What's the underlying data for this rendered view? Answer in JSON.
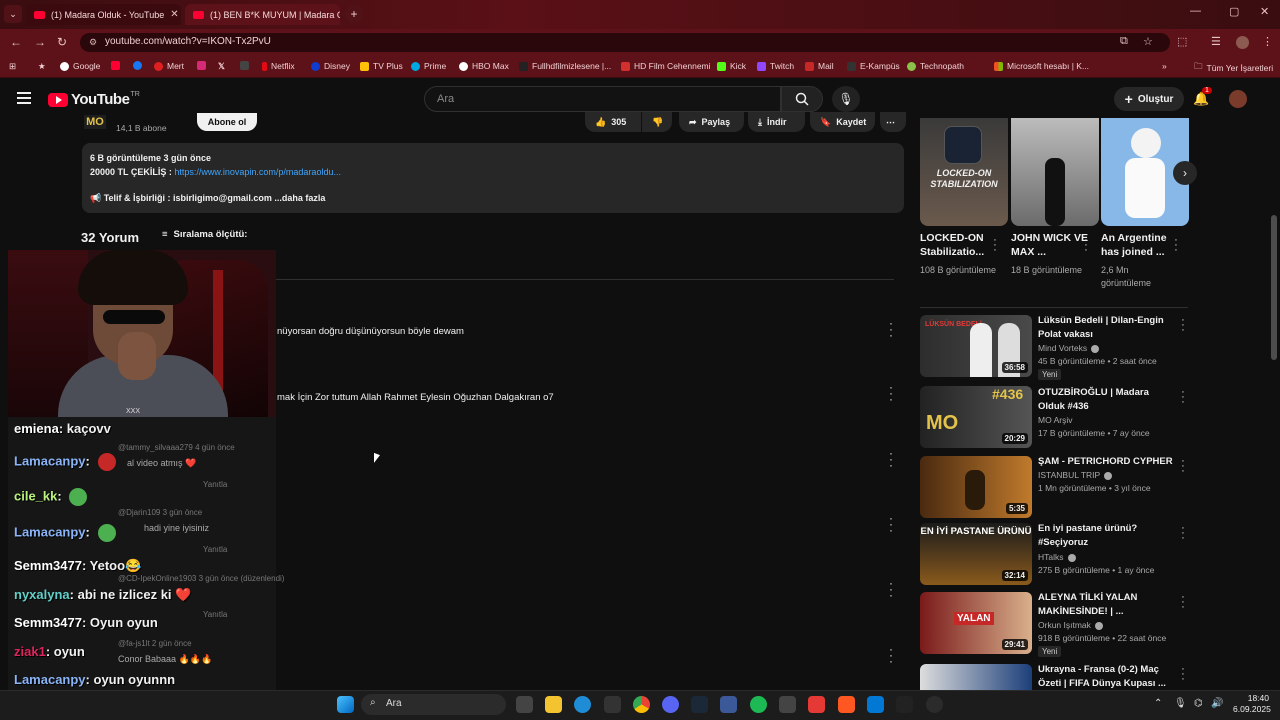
{
  "browser": {
    "tabs": [
      {
        "label": "(1) Madara Olduk - YouTube",
        "close": "✕"
      },
      {
        "label": "(1) BEN B*K MUYUM | Madara O",
        "close": "✕"
      }
    ],
    "new_tab": "+",
    "url": "youtube.com/watch?v=IKON-Tx2PvU",
    "bookmarks": [
      "Google",
      "Facebook",
      "Mert",
      "Instagram",
      "X",
      "Netflix",
      "Disney",
      "TV Plus",
      "Prime",
      "HBO Max",
      "Fullhdfilmizlesene |...",
      "HD Film Cehennemi",
      "Kick",
      "Twitch",
      "Mail",
      "E-Kampüs",
      "Technopath",
      "Microsoft hesabı | K..."
    ],
    "all_bookmarks": "Tüm Yer İşaretleri",
    "accent": "#5c1218"
  },
  "header": {
    "logo": "YouTube",
    "logo_sup": "TR",
    "search_placeholder": "Ara",
    "create_label": "Oluştur",
    "notif_count": "1"
  },
  "video": {
    "subs": "14,1 B abone",
    "subscribe": "Abone ol",
    "likes": "305",
    "share": "Paylaş",
    "download": "İndir",
    "save": "Kaydet"
  },
  "description": {
    "stats": "6 B görüntüleme  3 gün önce",
    "line1_prefix": "20000 TL ÇEKİLİŞ : ",
    "line1_link": "https://www.inovapin.com/p/madaraoldu...",
    "line2_prefix": "📢 Telif & İşbirliği : isbirligimo@gmail.com",
    "line2_more": "  ...daha fazla"
  },
  "comments": {
    "count": "32 Yorum",
    "sort": "Sıralama ölçütü:",
    "visible": [
      "nüyorsan doğru düşünüyorsun böyle dewam",
      "mak İçin Zor tuttum Allah Rahmet Eylesin Oğuzhan Dalgakıran o7"
    ],
    "ghosts": [
      {
        "user": "@tammy_silvaaa279",
        "time": "4 gün önce",
        "text": "al video atmış ❤️",
        "reply": "Yanıtla"
      },
      {
        "user": "@Djarin109",
        "time": "3 gün önce",
        "text": "hadi yine iyisiniz",
        "reply": "Yanıtla"
      },
      {
        "user": "@CD-IpekOnline1903",
        "time": "3 gün önce (düzenlendi)",
        "text": "",
        "reply": "Yanıtla"
      },
      {
        "user": "@fa-js1lt",
        "time": "2 gün önce",
        "text": "Conor Babaaa 🔥🔥🔥",
        "reply": ""
      }
    ]
  },
  "chat": [
    {
      "user": "emiena",
      "msg": "kaçovv",
      "color": "#ffffff"
    },
    {
      "user": "Lamacanpy",
      "msg": "",
      "color": "#8ab4f8"
    },
    {
      "user": "cile_kk",
      "msg": "",
      "color": "#b9f27c"
    },
    {
      "user": "Lamacanpy",
      "msg": "",
      "color": "#8ab4f8"
    },
    {
      "user": "Semm3477",
      "msg": "Yetoo😂",
      "color": "#ffffff"
    },
    {
      "user": "nyxalyna",
      "msg": "abi ne izlicez ki ❤️",
      "color": "#62d0c8"
    },
    {
      "user": "Semm3477",
      "msg": "Oyun oyun",
      "color": "#ffffff"
    },
    {
      "user": "ziak1",
      "msg": "oyun",
      "color": "#e0245e"
    },
    {
      "user": "Lamacanpy",
      "msg": "oyun oyunnn",
      "color": "#8ab4f8"
    }
  ],
  "webcam_logo": "XXX",
  "shorts": [
    {
      "title": "LOCKED-ON Stabilizatio...",
      "views": "108 B görüntüleme",
      "thumb_text": "LOCKED-ON STABILIZATION"
    },
    {
      "title": "JOHN WICK VE MAX ...",
      "views": "18 B görüntüleme"
    },
    {
      "title": "An Argentine has joined ...",
      "views": "2,6 Mn görüntüleme"
    }
  ],
  "related": [
    {
      "title": "Lüksün Bedeli | Dilan-Engin Polat vakası",
      "channel": "Mind Vorteks",
      "meta": "45 B görüntüleme • 2 saat önce",
      "duration": "36:58",
      "new": "Yeni",
      "thumb_text": "LÜKSÜN BEDELİ"
    },
    {
      "title": "OTUZBİROĞLU | Madara Olduk #436",
      "channel": "MO Arşiv",
      "meta": "17 B görüntüleme • 7 ay önce",
      "duration": "20:29",
      "new": "",
      "thumb_text": "#436"
    },
    {
      "title": "ŞAM - PETRICHORD CYPHER",
      "channel": "ISTANBUL TRIP",
      "meta": "1 Mn görüntüleme • 3 yıl önce",
      "duration": "5:35",
      "new": ""
    },
    {
      "title": "En iyi pastane ürünü? #Seçiyoruz",
      "channel": "HTalks",
      "meta": "275 B görüntüleme • 1 ay önce",
      "duration": "32:14",
      "new": "",
      "thumb_text": "EN İYİ PASTANE ÜRÜNÜ"
    },
    {
      "title": "ALEYNA TİLKİ YALAN MAKİNESİNDE! | ...",
      "channel": "Orkun Işıtmak",
      "meta": "918 B görüntüleme • 22 saat önce",
      "duration": "29:41",
      "new": "Yeni",
      "thumb_text": "YALAN"
    },
    {
      "title": "Ukrayna - Fransa (0-2) Maç Özeti | FIFA Dünya Kupası ...",
      "channel": "",
      "meta": "",
      "duration": "",
      "new": ""
    }
  ],
  "taskbar": {
    "search": "Ara",
    "time": "18:40",
    "date": "6.09.2025"
  }
}
